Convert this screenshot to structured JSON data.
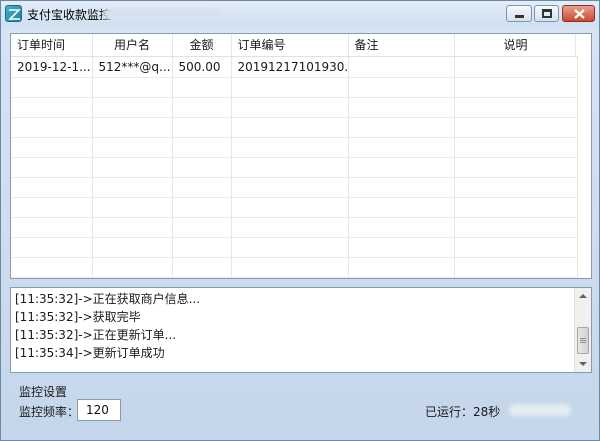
{
  "window": {
    "title": "支付宝收款监控",
    "controls": {
      "minimize": "minimize-icon",
      "maximize": "maximize-icon",
      "close": "close-icon"
    }
  },
  "orders": {
    "columns": [
      "订单时间",
      "用户名",
      "金额",
      "订单编号",
      "备注",
      "说明"
    ],
    "rows": [
      {
        "time": "2019-12-1...",
        "user": "512***@q...",
        "amount": "500.00",
        "order_no": "20191217101930...",
        "note": "",
        "desc": ""
      }
    ],
    "empty_rows": 11
  },
  "log": {
    "lines": [
      "[11:35:32]->正在获取商户信息...",
      "[11:35:32]->获取完毕",
      "[11:35:32]->正在更新订单...",
      "[11:35:34]->更新订单成功"
    ]
  },
  "settings": {
    "group_label": "监控设置",
    "freq_label": "监控频率：",
    "freq_value": "120",
    "runtime_label": "已运行：",
    "runtime_value": "28秒"
  },
  "colors": {
    "accent": "#1d7da0",
    "close": "#c84a32",
    "frame": "#c5d6ea"
  }
}
